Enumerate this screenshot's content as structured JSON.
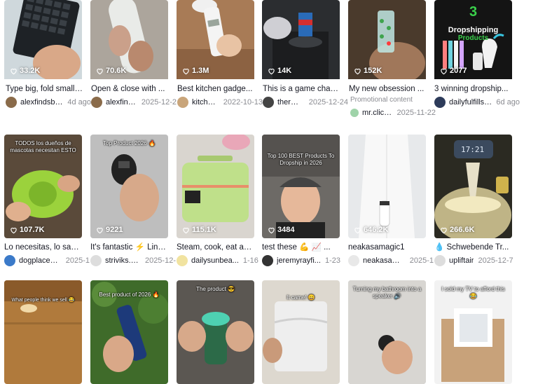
{
  "videos": [
    {
      "likes": "33.2K",
      "caption": "Type big, fold small....",
      "author": "alexfindsbest",
      "date": "4d ago",
      "avatar_color": "#8a6b4a"
    },
    {
      "likes": "70.6K",
      "caption": "Open & close with ...",
      "author": "alexfindsbest",
      "date": "2025-12-2",
      "avatar_color": "#8a6b4a"
    },
    {
      "likes": "1.3M",
      "caption": "Best kitchen gadge...",
      "author": "kitchencon...",
      "date": "2022-10-13",
      "avatar_color": "#c9a57a"
    },
    {
      "likes": "14K",
      "caption": "This is a game chan...",
      "author": "thermacups...",
      "date": "2025-12-24",
      "avatar_color": "#444444"
    },
    {
      "likes": "152K",
      "caption": "My new obsession ...",
      "promo": "Promotional content",
      "author": "mr.clickie",
      "date": "2025-11-22",
      "avatar_color": "#9fd3a9"
    },
    {
      "likes": "2077",
      "caption": "3 winning dropship...",
      "author": "dailyfulfillso...",
      "date": "6d ago",
      "avatar_color": "#2d3b5a",
      "overlay_number": "3",
      "overlay_title": "Dropshipping",
      "overlay_sub": "Products"
    },
    {
      "likes": "107.7K",
      "caption": "Lo necesitas, lo sab...",
      "author": "dogplacest...",
      "date": "2025-1",
      "avatar_color": "#3b7ac9",
      "overlay": "TODOS los dueños de mascotas necesitan ESTO"
    },
    {
      "likes": "9221",
      "caption": "It's fantastic ⚡ Link...",
      "author": "striviks.store",
      "date": "2025-12-",
      "avatar_color": "#dddddd",
      "overlay": "Top Product 2026 🔥"
    },
    {
      "likes": "115.1K",
      "caption": "Steam, cook, eat an...",
      "author": "dailysunbea...",
      "date": "1-16",
      "avatar_color": "#f1e3a0"
    },
    {
      "likes": "3484",
      "caption": "test these 💪 📈 ...",
      "author": "jeremyrayfi...",
      "date": "1-23",
      "avatar_color": "#333333",
      "overlay": "Top 100 BEST Products To Dropship in 2026"
    },
    {
      "likes": "646.2K",
      "caption": "neakasamagic1",
      "author": "neakasama...",
      "date": "2025-1",
      "avatar_color": "#e8e8e8"
    },
    {
      "likes": "266.6K",
      "caption": "💧 Schwebende Tr...",
      "author": "upliftair",
      "date": "2025-12-7",
      "avatar_color": "#dddddd",
      "clock": "17:21"
    },
    {
      "overlay": "What people think we sell 😂"
    },
    {
      "overlay": "Best product of 2026 🔥"
    },
    {
      "overlay": "The product 😎"
    },
    {
      "overlay": "It came! 😄"
    },
    {
      "overlay": "Turning my bathroom into a speaker 🔊"
    },
    {
      "overlay": "I sold my TV to afford this 😂"
    }
  ]
}
